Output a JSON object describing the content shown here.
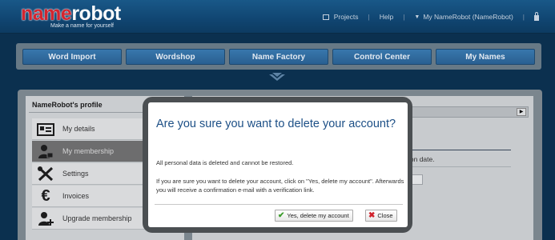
{
  "brand": {
    "logo_part1": "name",
    "logo_part2": "robot",
    "tagline": "Make a name for yourself",
    "accent_red": "#d8262f",
    "header_blue": "#114773",
    "title_blue": "#1c4f86"
  },
  "topnav": {
    "projects": "Projects",
    "help": "Help",
    "account": "My NameRobot (NameRobot)",
    "sep": "|"
  },
  "mainnav": {
    "items": [
      "Word Import",
      "Wordshop",
      "Name Factory",
      "Control Center",
      "My Names"
    ]
  },
  "profile": {
    "title": "NameRobot's profile",
    "menu": [
      {
        "label": "My details",
        "icon": "id-card-icon"
      },
      {
        "label": "My membership",
        "icon": "user-lock-icon"
      },
      {
        "label": "Settings",
        "icon": "tools-icon"
      },
      {
        "label": "Invoices",
        "icon": "euro-icon"
      },
      {
        "label": "Upgrade membership",
        "icon": "user-add-icon"
      }
    ]
  },
  "background_panel": {
    "partial_text": "ion date."
  },
  "modal": {
    "title": "Are you sure you want to delete your account?",
    "paragraph1": "All personal data is deleted and cannot be restored.",
    "paragraph2": "If you are sure you want to delete your account, click on \"Yes, delete my account\". Afterwards you will receive a confirmation e-mail with a verification link.",
    "confirm_label": "Yes, delete my account",
    "close_label": "Close"
  }
}
